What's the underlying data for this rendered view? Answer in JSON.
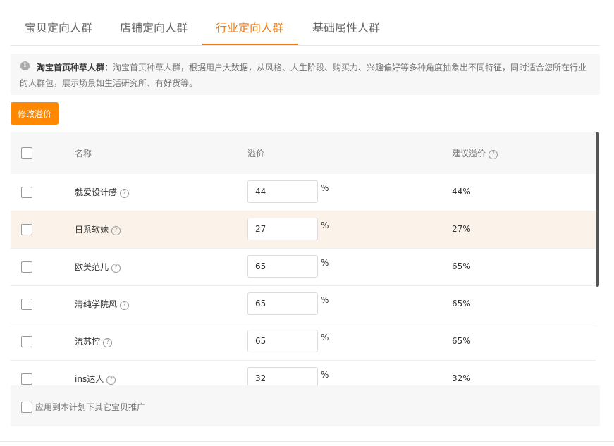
{
  "tabs": [
    {
      "label": "宝贝定向人群"
    },
    {
      "label": "店铺定向人群"
    },
    {
      "label": "行业定向人群",
      "active": true
    },
    {
      "label": "基础属性人群"
    }
  ],
  "notice": {
    "icon": "info-icon",
    "title": "淘宝首页种草人群：",
    "text": "淘宝首页种草人群，根据用户大数据，从风格、人生阶段、购买力、兴趣偏好等多种角度抽象出不同特征，同时适合您所在行业的人群包，展示场景如生活研究所、有好货等。"
  },
  "toolbar": {
    "modify_label": "修改溢价"
  },
  "table": {
    "headers": {
      "name": "名称",
      "premium": "溢价",
      "suggest": "建议溢价"
    },
    "rows": [
      {
        "name": "就爱设计感",
        "value": "44",
        "unit": "%",
        "suggest": "44%"
      },
      {
        "name": "日系软妹",
        "value": "27",
        "unit": "%",
        "suggest": "27%"
      },
      {
        "name": "欧美范儿",
        "value": "65",
        "unit": "%",
        "suggest": "65%"
      },
      {
        "name": "清纯学院风",
        "value": "65",
        "unit": "%",
        "suggest": "65%"
      },
      {
        "name": "流苏控",
        "value": "65",
        "unit": "%",
        "suggest": "65%"
      },
      {
        "name": "ins达人",
        "value": "32",
        "unit": "%",
        "suggest": "32%"
      }
    ]
  },
  "footer": {
    "apply_label": "应用到本计划下其它宝贝推广"
  },
  "colors": {
    "accent": "#ff8800",
    "tab_active": "#f07b13",
    "hover_row": "#fbf3ea"
  }
}
